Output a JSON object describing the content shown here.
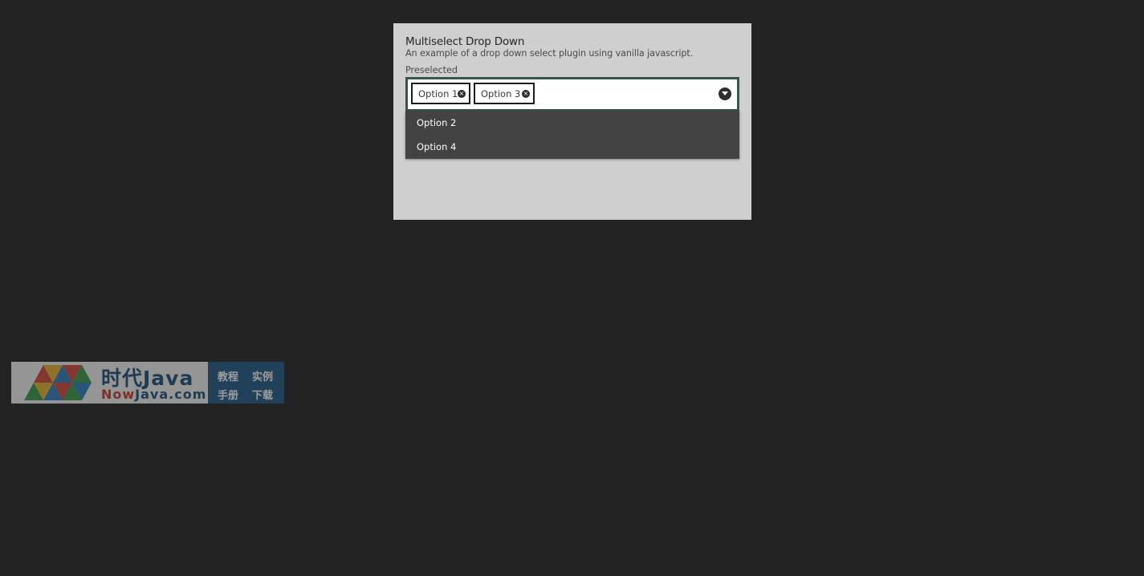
{
  "panel": {
    "title": "Multiselect Drop Down",
    "description": "An example of a drop down select plugin using vanilla javascript."
  },
  "field": {
    "label": "Preselected",
    "selected": [
      {
        "label": "Option 1",
        "remove_icon": "close-circle-icon"
      },
      {
        "label": "Option 3",
        "remove_icon": "close-circle-icon"
      }
    ],
    "toggle_icon": "chevron-down-circle-icon",
    "border_color": "#36574a"
  },
  "dropdown": {
    "options": [
      {
        "label": "Option 2"
      },
      {
        "label": "Option 4"
      }
    ],
    "background": "#434343"
  },
  "watermark": {
    "brand_top": "时代Java",
    "brand_bottom_prefix": "Now",
    "brand_bottom_suffix": "Java.com",
    "links": [
      "教程",
      "实例",
      "手册",
      "下载"
    ]
  }
}
